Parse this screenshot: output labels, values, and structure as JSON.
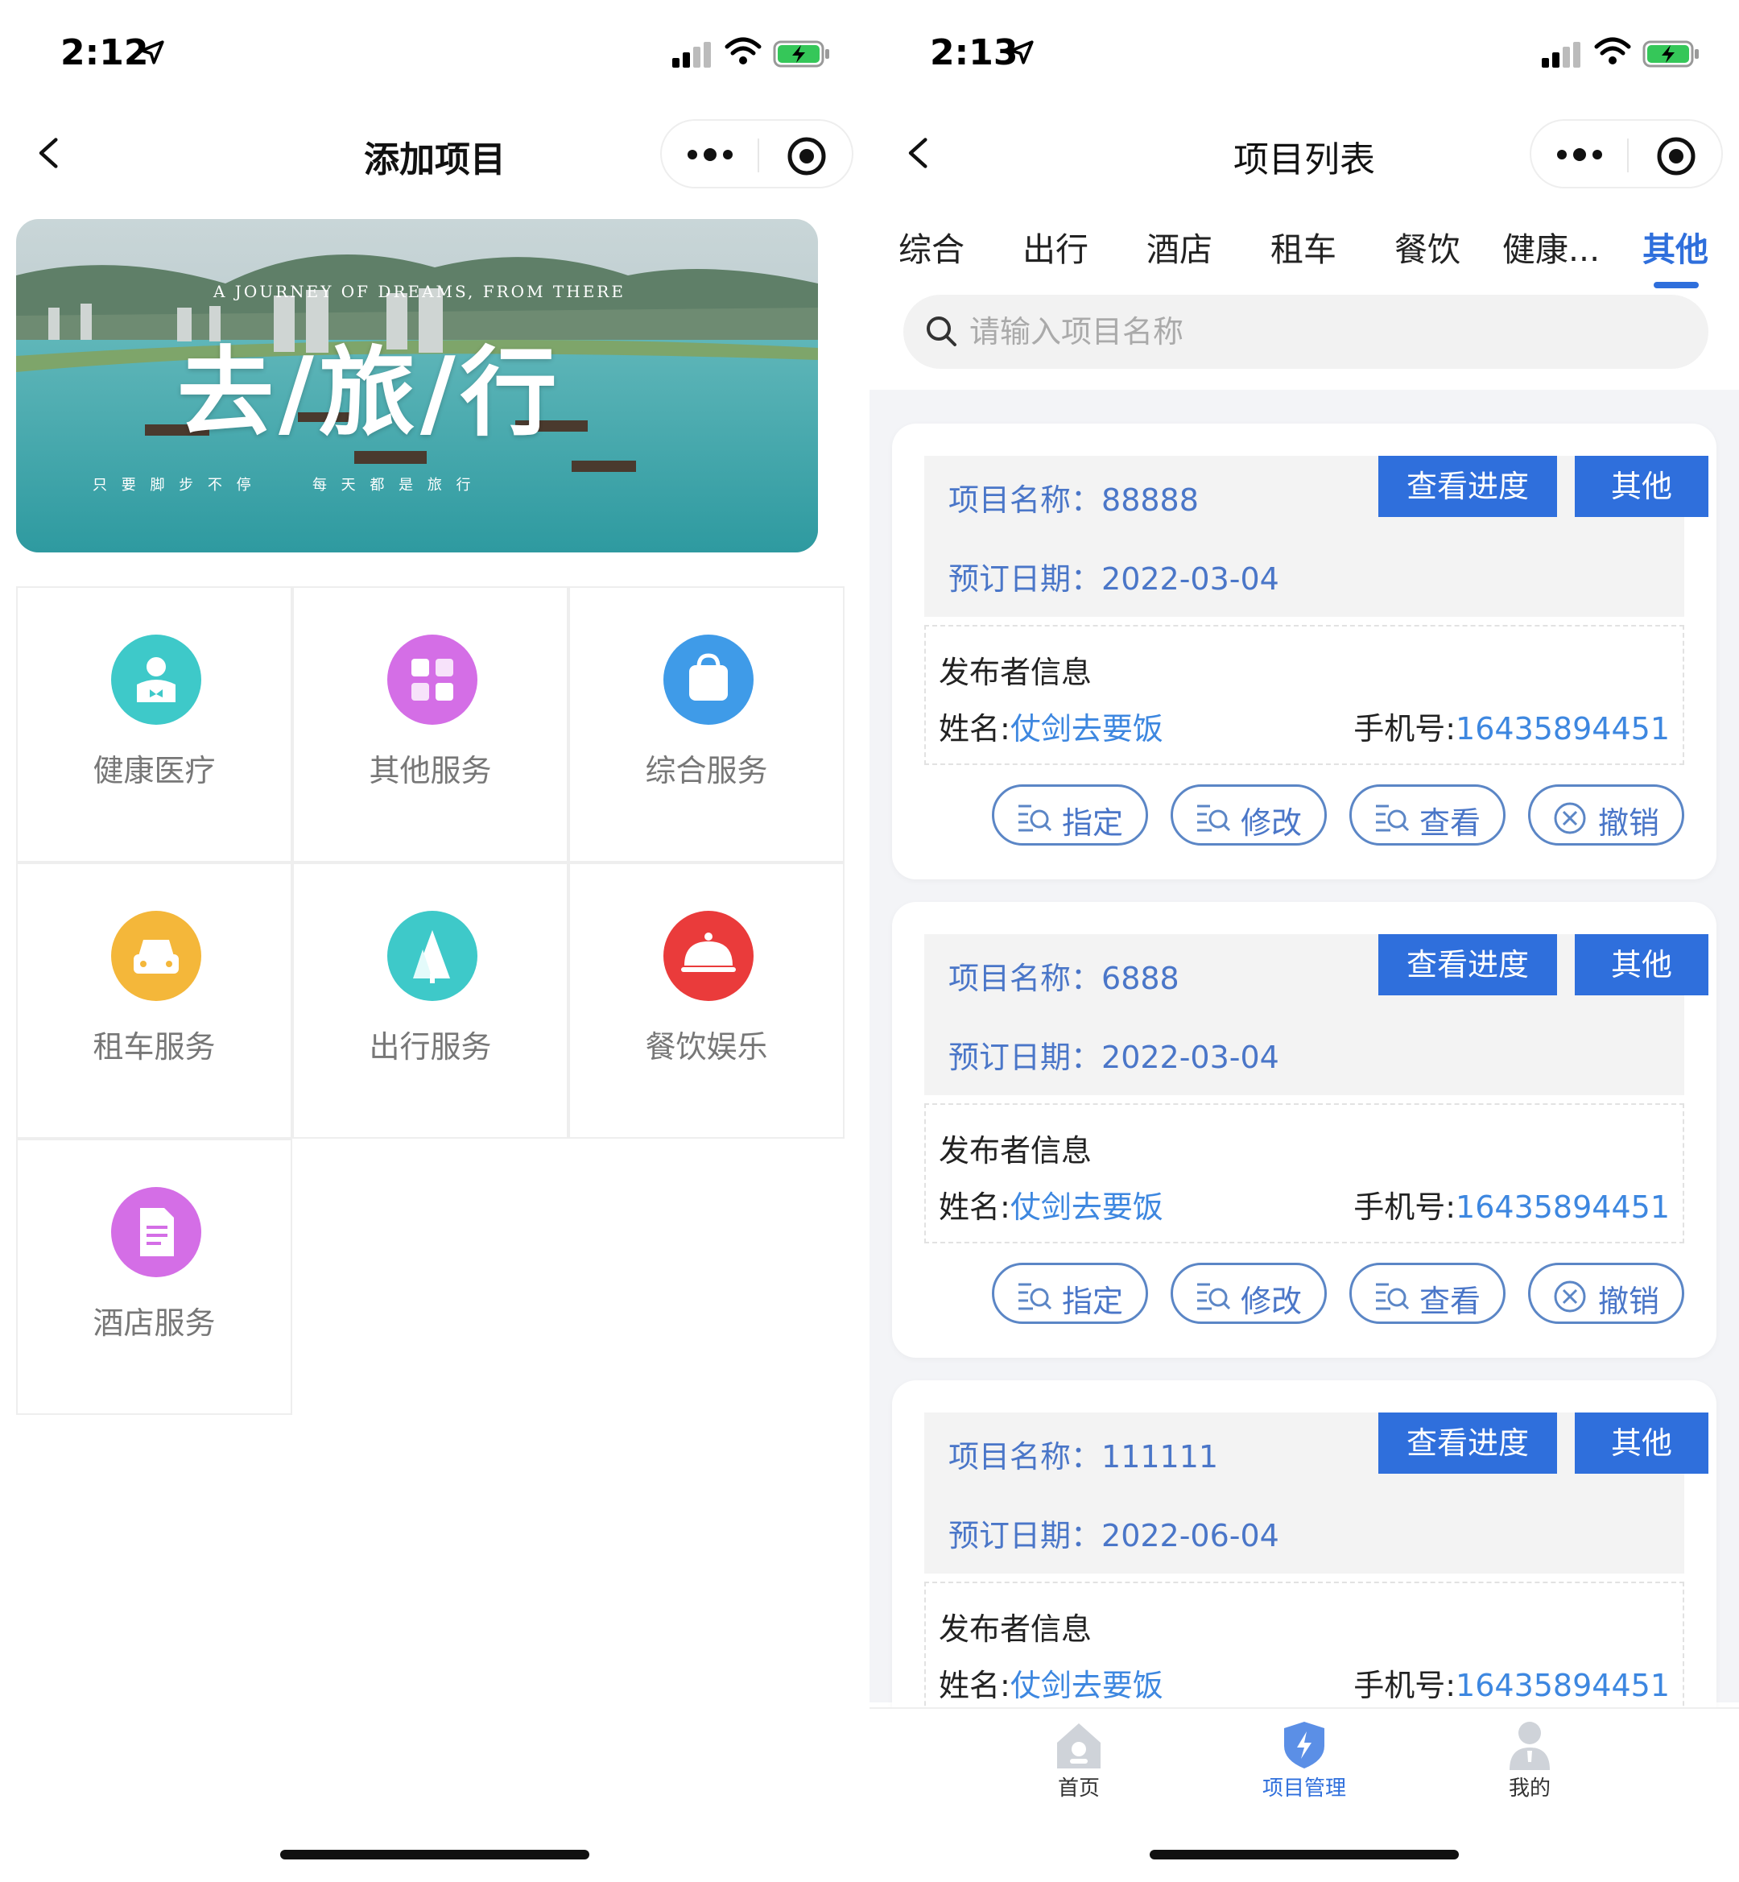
{
  "left": {
    "status": {
      "time": "2:12"
    },
    "navbar": {
      "title": "添加项目"
    },
    "banner": {
      "subtitle": "A JOURNEY OF DREAMS, FROM THERE",
      "headline": "去/旅/行",
      "tagline": "只 要 脚 步 不 停      每 天 都 是 旅 行"
    },
    "services": [
      {
        "label": "健康医疗",
        "icon": "health-icon",
        "color": "#3ec9c9"
      },
      {
        "label": "其他服务",
        "icon": "grid-icon",
        "color": "#d46ee6"
      },
      {
        "label": "综合服务",
        "icon": "bag-icon",
        "color": "#3f9be8"
      },
      {
        "label": "租车服务",
        "icon": "car-icon",
        "color": "#f4b73a"
      },
      {
        "label": "出行服务",
        "icon": "tree-icon",
        "color": "#3ec9c9"
      },
      {
        "label": "餐饮娱乐",
        "icon": "dish-icon",
        "color": "#ea3b3b"
      },
      {
        "label": "酒店服务",
        "icon": "document-icon",
        "color": "#d46ee6"
      }
    ]
  },
  "right": {
    "status": {
      "time": "2:13"
    },
    "navbar": {
      "title": "项目列表"
    },
    "tabs": [
      "综合",
      "出行",
      "酒店",
      "租车",
      "餐饮",
      "健康...",
      "其他"
    ],
    "active_tab": "其他",
    "search": {
      "placeholder": "请输入项目名称"
    },
    "labels": {
      "name_prefix": "项目名称：",
      "date_prefix": "预订日期：",
      "progress": "查看进度",
      "other": "其他",
      "publisher": "发布者信息",
      "person_prefix": "姓名:",
      "phone_prefix": "手机号:",
      "assign": "指定",
      "edit": "修改",
      "view": "查看",
      "revoke": "撤销"
    },
    "projects": [
      {
        "name": "88888",
        "date": "2022-03-04",
        "person": "仗剑去要饭",
        "phone": "16435894451"
      },
      {
        "name": "6888",
        "date": "2022-03-04",
        "person": "仗剑去要饭",
        "phone": "16435894451"
      },
      {
        "name": "111111",
        "date": "2022-06-04",
        "person": "仗剑去要饭",
        "phone": "16435894451"
      }
    ],
    "tabbar": [
      {
        "label": "首页",
        "icon": "home-icon"
      },
      {
        "label": "项目管理",
        "icon": "shield-icon"
      },
      {
        "label": "我的",
        "icon": "user-icon"
      }
    ],
    "active_tabbar": "项目管理",
    "accent": "#2f6fdc"
  }
}
